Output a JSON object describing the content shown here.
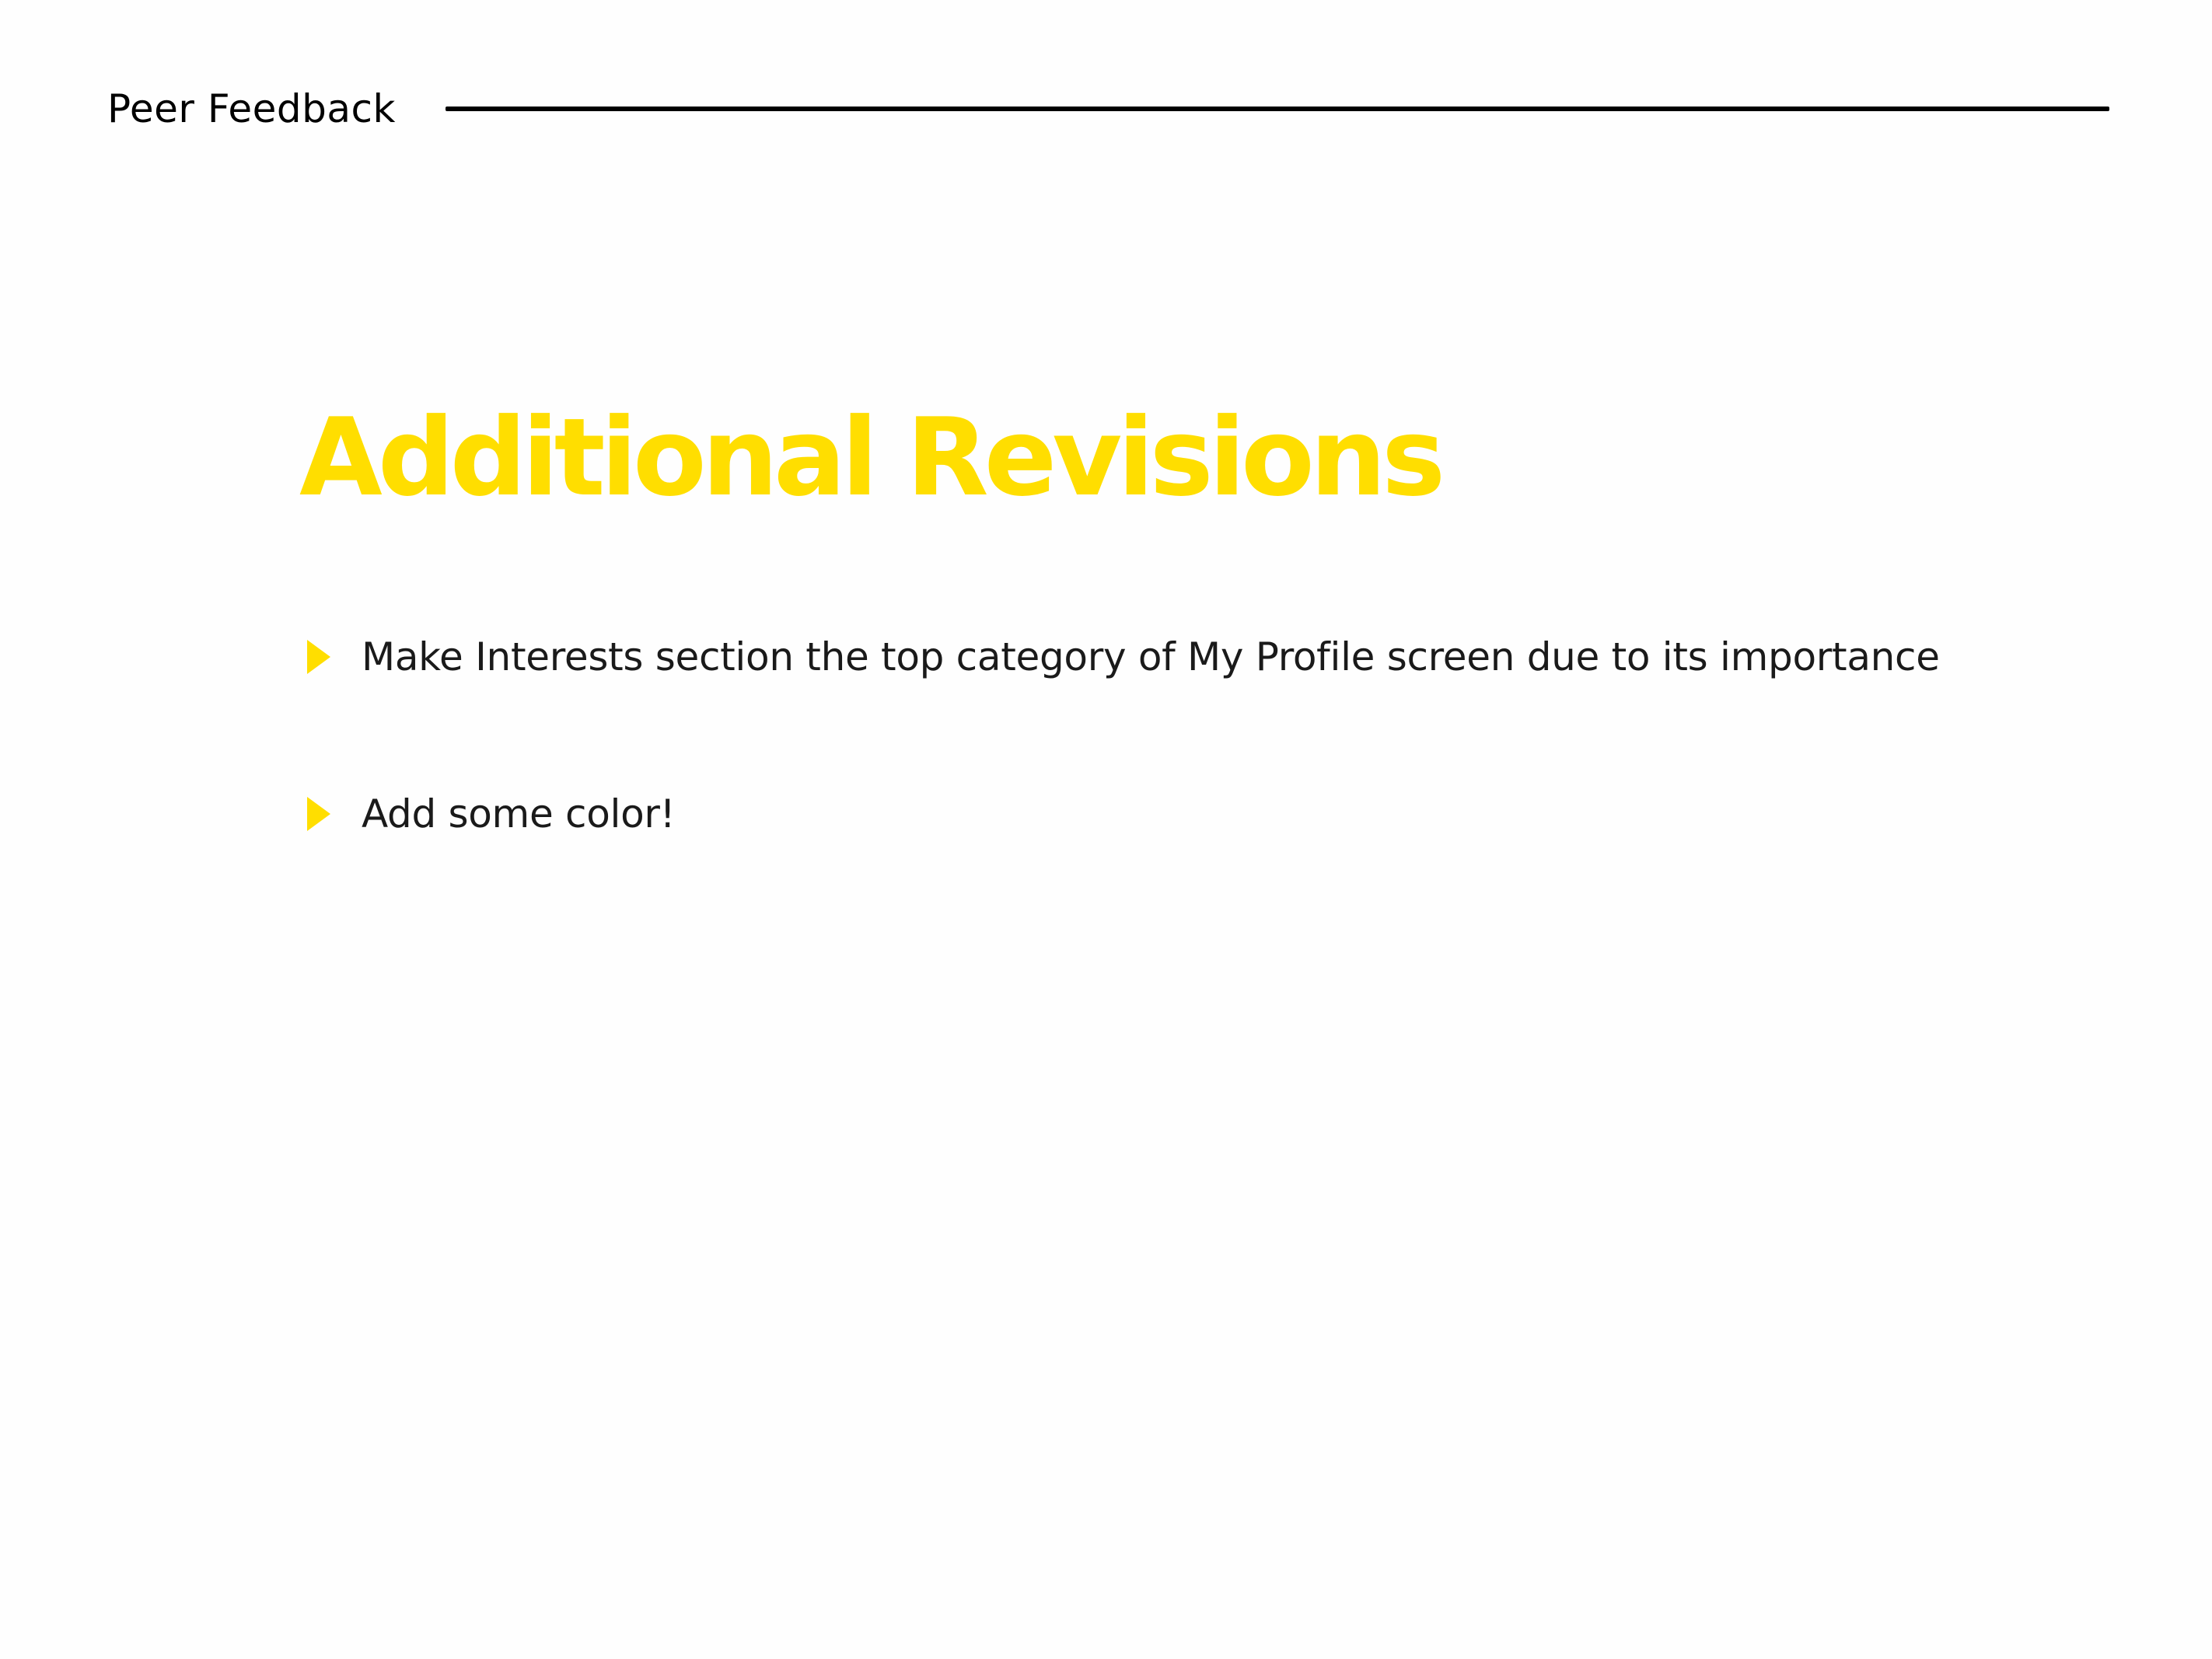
{
  "slide": {
    "section_label": "Peer Feedback",
    "title": "Additional Revisions",
    "bullets": [
      {
        "text": "Make Interests section the top category of My Profile screen due to its importance",
        "icon": "triangle-bullet-icon"
      },
      {
        "text": "Add some color!",
        "icon": "triangle-bullet-icon"
      }
    ]
  },
  "colors": {
    "accent": "#ffde00",
    "text": "#1a1a1a",
    "rule": "#000000",
    "background": "#fefefe"
  }
}
